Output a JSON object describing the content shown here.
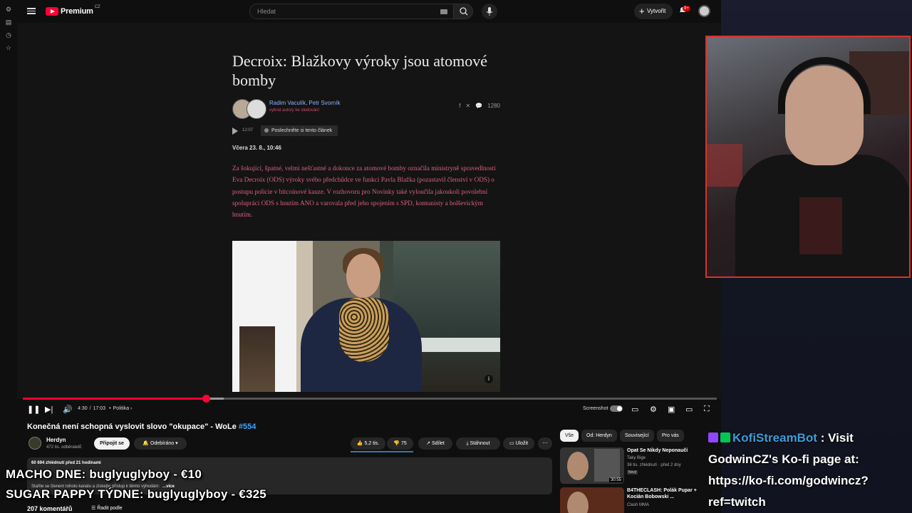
{
  "topbar": {
    "brand": "Premium",
    "region": "CZ",
    "search_placeholder": "Hledat",
    "create_label": "Vytvořit",
    "notifications_badge": "9+"
  },
  "article": {
    "title": "Decroix: Blažkovy výroky jsou atomové bomby",
    "authors": "Radim Vaculík, Petr Svorník",
    "authors_note": "vybrat autory ke sledování",
    "comments_count": "1280",
    "listen_time": "12:07",
    "listen_label": "Poslechněte si tento článek",
    "date": "Včera 23. 8., 10:46",
    "lead": "Za šokující, špatné, velmi nešťastné a dokonce za atomové bomby označila ministryně spravedlnosti Eva Decroix (ODS) výroky svého předchůdce ve funkci Pavla Blažka (pozastavil členství v ODS) o postupu policie v bitcoinové kauze. V rozhovoru pro Novinky také vyloučila jakoukoli povolební spolupráci ODS s hnutím ANO a varovala před jeho spojením s SPD, komunisty a bolševickým hnutím."
  },
  "player": {
    "current_time": "4:30",
    "duration": "17:03",
    "chapter": "Politika",
    "progress_fraction": 0.264,
    "buffered_fraction": 0.29,
    "screenshot_label": "Screenshot"
  },
  "video": {
    "title": "Konečná není schopná vyslovit slovo \"okupace\" - WoLe",
    "hashtag": "#554",
    "channel": "Herdyn",
    "subscribers": "472 tis. odběratelů",
    "join_label": "Připojit se",
    "subscribed_label": "Odebíráno",
    "likes": "5,2 tis.",
    "dislikes": "75",
    "share_label": "Sdílet",
    "download_label": "Stáhnout",
    "save_label": "Uložit",
    "views_line": "60 694 zhlédnutí  před 21 hodinami",
    "desc_line": "Staňte se členem tohoto kanálu a získejte přístup k těmto výhodám:",
    "more_label": "...více",
    "comments": "207 komentářů",
    "sort_label": "Řadit podle"
  },
  "recommend": {
    "chips": [
      "Vše",
      "Od: Herdyn",
      "Související",
      "Pro vás"
    ],
    "items": [
      {
        "title": "Opat Se Nikdy Neponaučí",
        "channel": "Taky Bige",
        "meta": "36 tis. zhlédnutí · před 2 dny",
        "badge": "Nový",
        "duration": "30:55"
      },
      {
        "title": "B4THECLASH: Polák Pupar + Kocián Bobowski ...",
        "channel": "Clash MMA",
        "meta": "",
        "badge": "",
        "duration": ""
      }
    ]
  },
  "stream": {
    "alert1": "MACHO DNE: buglyuglyboy - €10",
    "alert2": "SUGAR PAPPY TÝDNE: buglyuglyboy - €325",
    "chat_user": "KofiStreamBot",
    "chat_text": ": Visit GodwinCZ's Ko-fi page at: https://ko-fi.com/godwincz?ref=twitch"
  },
  "colors": {
    "accent": "#ff0033",
    "link": "#3ea6ff",
    "lead": "#d9607e",
    "bot": "#3d9dd9"
  }
}
